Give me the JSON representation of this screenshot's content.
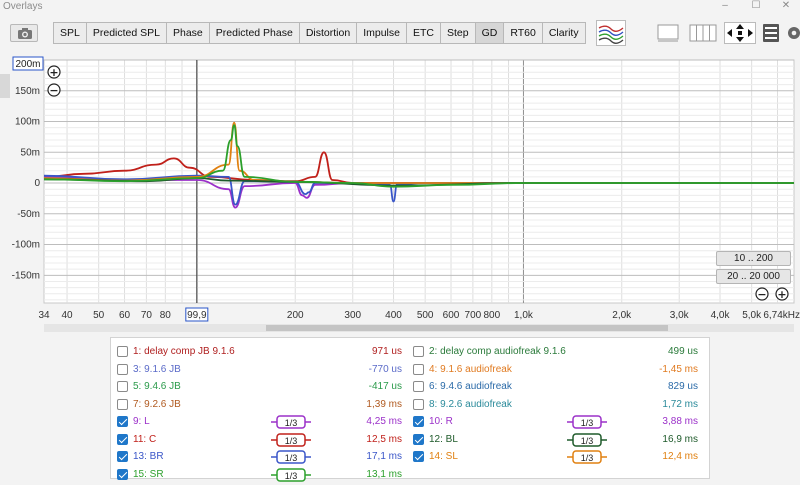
{
  "window": {
    "title": "Overlays",
    "minimize": "–",
    "maximize": "☐",
    "close": "✕"
  },
  "toolbar": {
    "tabs": [
      {
        "label": "SPL",
        "active": false
      },
      {
        "label": "Predicted SPL",
        "active": false
      },
      {
        "label": "Phase",
        "active": false
      },
      {
        "label": "Predicted Phase",
        "active": false
      },
      {
        "label": "Distortion",
        "active": false
      },
      {
        "label": "Impulse",
        "active": false
      },
      {
        "label": "ETC",
        "active": false
      },
      {
        "label": "Step",
        "active": false
      },
      {
        "label": "GD",
        "active": true
      },
      {
        "label": "RT60",
        "active": false
      },
      {
        "label": "Clarity",
        "active": false
      }
    ],
    "icons": [
      "camera-icon",
      "overlay-traces-icon",
      "layout-single-icon",
      "layout-columns-icon",
      "move-arrows-icon",
      "controls-panel-icon",
      "settings-gear-icon"
    ]
  },
  "chart_data": {
    "type": "line",
    "title": "",
    "y_unit": "ms",
    "y_ticks": [
      "150m",
      "100m",
      "50m",
      "0",
      "-50m",
      "-100m",
      "-150m"
    ],
    "y_top_value": "200m",
    "ylim": [
      -0.195,
      0.2
    ],
    "x_scale": "log",
    "xlim": [
      34,
      6740
    ],
    "x_ticks": [
      "34",
      "40",
      "50",
      "60",
      "70",
      "80",
      "99,9",
      "200",
      "300",
      "400",
      "500",
      "600",
      "700",
      "800",
      "1,0k",
      "2,0k",
      "3,0k",
      "4,0k",
      "5,0k",
      "6,74kHz"
    ],
    "cursor_x": 99.9,
    "cursor_label": "99,9",
    "grid": true,
    "zoom_y_label": "10 .. 200",
    "zoom_x_label": "20 .. 20 000",
    "series": [
      {
        "name": "11: C",
        "color": "#c0201a",
        "x": [
          34,
          45,
          60,
          75,
          85,
          95,
          110,
          150,
          200,
          230,
          245,
          260,
          300,
          1000,
          6740
        ],
        "y": [
          0.01,
          0.015,
          0.02,
          0.03,
          0.04,
          0.025,
          0.01,
          0.005,
          0.003,
          0.01,
          0.05,
          0.005,
          0.0,
          0.0,
          0.0
        ]
      },
      {
        "name": "9: L",
        "color": "#9b30c9",
        "x": [
          34,
          60,
          100,
          125,
          131,
          140,
          200,
          210,
          217,
          230,
          300,
          1000,
          6740
        ],
        "y": [
          0.01,
          0.005,
          0.005,
          -0.01,
          -0.04,
          -0.005,
          0.0,
          -0.02,
          -0.024,
          -0.003,
          0.0,
          0.0,
          0.0
        ]
      },
      {
        "name": "13: BR",
        "color": "#3a56c8",
        "x": [
          34,
          60,
          100,
          125,
          131,
          140,
          200,
          215,
          220,
          230,
          300,
          390,
          400,
          410,
          500,
          1000,
          6740
        ],
        "y": [
          0.012,
          0.006,
          0.012,
          0.01,
          -0.035,
          0.003,
          0.002,
          -0.018,
          -0.015,
          0.0,
          0.0,
          -0.003,
          -0.03,
          -0.002,
          0.0,
          0.0,
          0.0
        ]
      },
      {
        "name": "14: SL",
        "color": "#e08010",
        "x": [
          34,
          60,
          100,
          125,
          130,
          135,
          150,
          200,
          300,
          1000,
          6740
        ],
        "y": [
          0.008,
          0.004,
          0.01,
          0.03,
          0.098,
          0.02,
          0.005,
          0.002,
          0.0,
          0.0,
          0.0
        ]
      },
      {
        "name": "12: BL",
        "color": "#1e5a2a",
        "x": [
          34,
          70,
          100,
          125,
          200,
          400,
          1000,
          6740
        ],
        "y": [
          0.006,
          0.003,
          0.008,
          0.004,
          0.002,
          -0.004,
          0.0,
          0.0
        ]
      },
      {
        "name": "15: SR",
        "color": "#2ca02c",
        "x": [
          34,
          60,
          100,
          120,
          127,
          130,
          133,
          140,
          200,
          300,
          400,
          600,
          1000,
          6740
        ],
        "y": [
          0.006,
          0.003,
          0.008,
          0.02,
          0.07,
          0.094,
          0.06,
          0.01,
          0.002,
          0.0,
          -0.006,
          -0.003,
          0.0,
          0.0
        ]
      }
    ]
  },
  "legend": {
    "left": [
      {
        "label": "1: delay comp JB 9.1.6",
        "value": "971 us",
        "checked": false,
        "color": "#b02020",
        "smoothing": null
      },
      {
        "label": "3: 9.1.6 JB",
        "value": "-770 us",
        "checked": false,
        "color": "#5a6ac8",
        "smoothing": null
      },
      {
        "label": "5: 9.4.6 JB",
        "value": "-417 us",
        "checked": false,
        "color": "#2a9a4a",
        "smoothing": null
      },
      {
        "label": "7: 9.2.6 JB",
        "value": "1,39 ms",
        "checked": false,
        "color": "#b05a20",
        "smoothing": null
      },
      {
        "label": "9: L",
        "value": "4,25 ms",
        "checked": true,
        "color": "#9b30c9",
        "smoothing": "1/3"
      },
      {
        "label": "11: C",
        "value": "12,5 ms",
        "checked": true,
        "color": "#c0201a",
        "smoothing": "1/3"
      },
      {
        "label": "13: BR",
        "value": "17,1 ms",
        "checked": true,
        "color": "#3a56c8",
        "smoothing": "1/3"
      },
      {
        "label": "15: SR",
        "value": "13,1 ms",
        "checked": true,
        "color": "#2ca02c",
        "smoothing": "1/3"
      }
    ],
    "right": [
      {
        "label": "2: delay comp audiofreak 9.1.6",
        "value": "499 us",
        "checked": false,
        "color": "#2a7a3a",
        "smoothing": null
      },
      {
        "label": "4: 9.1.6 audiofreak",
        "value": "-1,45 ms",
        "checked": false,
        "color": "#e07a20",
        "smoothing": null
      },
      {
        "label": "6: 9.4.6 audiofreak",
        "value": "829 us",
        "checked": false,
        "color": "#2a6aa8",
        "smoothing": null
      },
      {
        "label": "8: 9.2.6 audiofreak",
        "value": "1,72 ms",
        "checked": false,
        "color": "#2a8a9a",
        "smoothing": null
      },
      {
        "label": "10: R",
        "value": "3,88 ms",
        "checked": true,
        "color": "#9b30c9",
        "smoothing": "1/3"
      },
      {
        "label": "12: BL",
        "value": "16,9 ms",
        "checked": true,
        "color": "#1e5a2a",
        "smoothing": "1/3"
      },
      {
        "label": "14: SL",
        "value": "12,4 ms",
        "checked": true,
        "color": "#e08010",
        "smoothing": "1/3"
      }
    ]
  }
}
